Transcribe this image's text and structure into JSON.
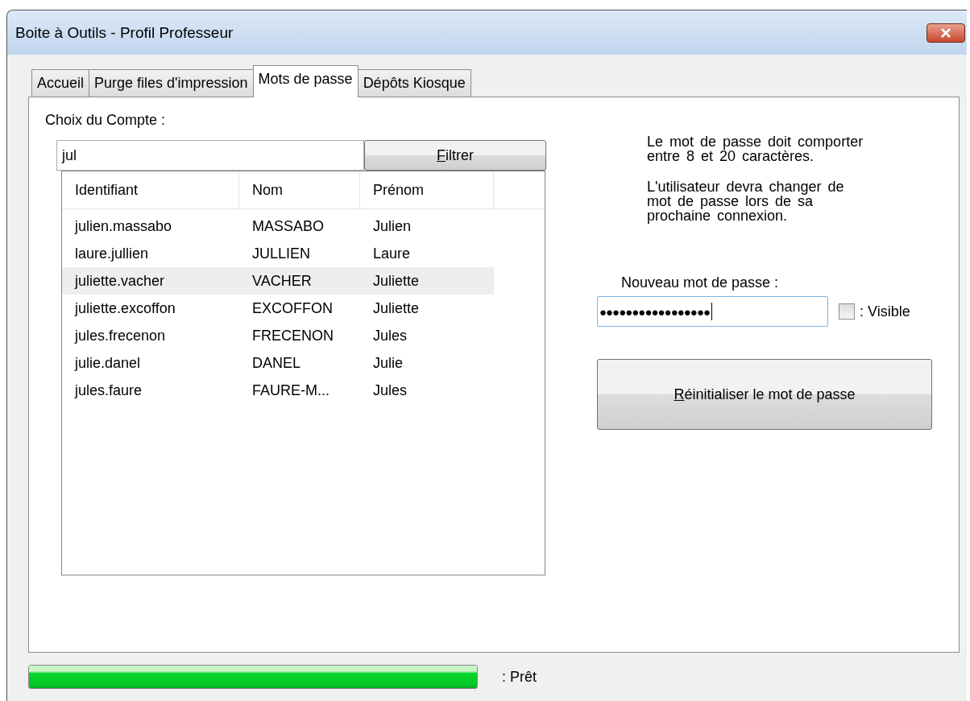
{
  "window": {
    "title": "Boite à Outils - Profil Professeur"
  },
  "tabs": [
    {
      "label": "Accueil",
      "selected": false
    },
    {
      "label": "Purge files d'impression",
      "selected": false
    },
    {
      "label": "Mots de passe",
      "selected": true
    },
    {
      "label": "Dépôts Kiosque",
      "selected": false
    }
  ],
  "account": {
    "label": "Choix du Compte :",
    "filter_value": "jul",
    "filter_button": "Filtrer",
    "columns": [
      "Identifiant",
      "Nom",
      "Prénom"
    ],
    "rows": [
      {
        "cells": [
          "julien.massabo",
          "MASSABO",
          "Julien"
        ],
        "selected": false
      },
      {
        "cells": [
          "laure.jullien",
          "JULLIEN",
          "Laure"
        ],
        "selected": false
      },
      {
        "cells": [
          "juliette.vacher",
          "VACHER",
          "Juliette"
        ],
        "selected": true
      },
      {
        "cells": [
          "juliette.excoffon",
          "EXCOFFON",
          "Juliette"
        ],
        "selected": false
      },
      {
        "cells": [
          "jules.frecenon",
          "FRECENON",
          "Jules"
        ],
        "selected": false
      },
      {
        "cells": [
          "julie.danel",
          "DANEL",
          "Julie"
        ],
        "selected": false
      },
      {
        "cells": [
          "jules.faure",
          "FAURE-M...",
          "Jules"
        ],
        "selected": false
      }
    ]
  },
  "password": {
    "rule": "Le mot de passe doit comporter entre 8 et 20 caractères.",
    "notice": "L'utilisateur devra changer de mot de passe lors de sa prochaine connexion.",
    "label": "Nouveau mot de passe :",
    "value": "●●●●●●●●●●●●●●●●●",
    "visible_label": ": Visible",
    "visible": false,
    "reset_button": "Réinitialiser le mot de passe"
  },
  "status": {
    "level": 1,
    "text": ":  Prêt"
  }
}
